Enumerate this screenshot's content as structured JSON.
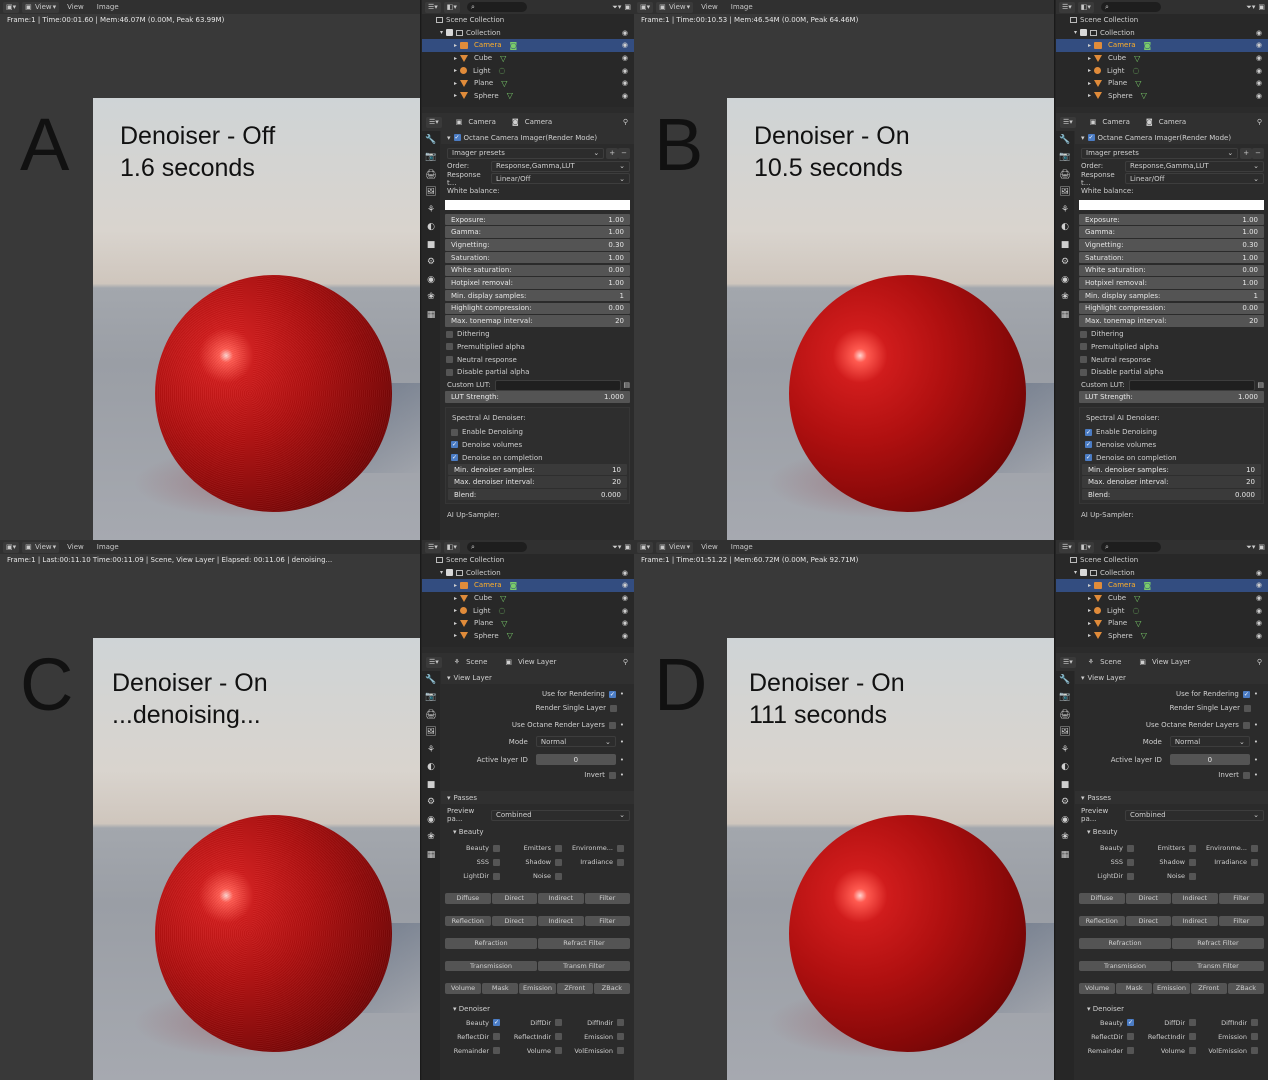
{
  "header": {
    "view": "View",
    "view_menu": "View",
    "image_menu": "Image"
  },
  "quads": [
    {
      "id": "A",
      "letter": "A",
      "line1": "Denoiser - Off",
      "line2": "1.6 seconds",
      "status": "Frame:1 | Time:00:01.60 | Mem:46.07M (0.00M, Peak 63.99M)"
    },
    {
      "id": "B",
      "letter": "B",
      "line1": "Denoiser - On",
      "line2": "10.5 seconds",
      "status": "Frame:1 | Time:00:10.53 | Mem:46.54M (0.00M, Peak 64.46M)"
    },
    {
      "id": "C",
      "letter": "C",
      "line1": "Denoiser - On",
      "line2": "...denoising...",
      "status": "Frame:1 | Last:00:11.10 Time:00:11.09 | Scene, View Layer | Elapsed: 00:11.06 | denoising..."
    },
    {
      "id": "D",
      "letter": "D",
      "line1": "Denoiser - On",
      "line2": "111 seconds",
      "status": "Frame:1 | Time:01:51.22 | Mem:60.72M (0.00M, Peak 92.71M)"
    }
  ],
  "outliner": {
    "root": "Scene Collection",
    "collection": "Collection",
    "items": [
      "Camera",
      "Cube",
      "Light",
      "Plane",
      "Sphere"
    ]
  },
  "camera_panel": {
    "tab1": "Camera",
    "tab2": "Camera",
    "section": "Octane Camera Imager(Render Mode)",
    "presets": "Imager presets",
    "order_label": "Order:",
    "order_value": "Response,Gamma,LUT",
    "response_label": "Response t...",
    "response_value": "Linear/Off",
    "wb_label": "White balance:",
    "sliders": [
      [
        "Exposure:",
        "1.00"
      ],
      [
        "Gamma:",
        "1.00"
      ],
      [
        "Vignetting:",
        "0.30"
      ],
      [
        "Saturation:",
        "1.00"
      ],
      [
        "White saturation:",
        "0.00"
      ],
      [
        "Hotpixel removal:",
        "1.00"
      ],
      [
        "Min. display samples:",
        "1"
      ],
      [
        "Highlight compression:",
        "0.00"
      ],
      [
        "Max. tonemap interval:",
        "20"
      ]
    ],
    "checks": [
      "Dithering",
      "Premultiplied alpha",
      "Neutral response",
      "Disable partial alpha"
    ],
    "lut_label": "Custom LUT:",
    "lut_strength": "LUT Strength:",
    "lut_strength_val": "1.000",
    "denoiser_title": "Spectral AI Denoiser:",
    "denoiser_checks": [
      "Enable Denoising",
      "Denoise volumes",
      "Denoise on completion"
    ],
    "denoiser_state_A": [
      false,
      true,
      true
    ],
    "denoiser_state_B": [
      true,
      true,
      true
    ],
    "denoiser_sliders": [
      [
        "Min. denoiser samples:",
        "10"
      ],
      [
        "Max. denoiser interval:",
        "20"
      ],
      [
        "Blend:",
        "0.000"
      ]
    ],
    "upsampler": "AI Up-Sampler:"
  },
  "viewlayer_panel": {
    "tab1": "Scene",
    "tab2": "View Layer",
    "section": "View Layer",
    "use_rendering": "Use for Rendering",
    "single_layer": "Render Single Layer",
    "octane_layers": "Use Octane Render Layers",
    "mode_label": "Mode",
    "mode_value": "Normal",
    "layer_id_label": "Active layer ID",
    "layer_id_value": "0",
    "invert": "Invert",
    "passes": "Passes",
    "preview_label": "Preview pa...",
    "preview_value": "Combined",
    "beauty": "Beauty",
    "beauty_checks": [
      [
        "Beauty",
        "Emitters",
        "Environme..."
      ],
      [
        "SSS",
        "Shadow",
        "Irradiance"
      ],
      [
        "LightDir",
        "Noise",
        ""
      ]
    ],
    "btn_rows": [
      [
        "Diffuse",
        "Direct",
        "Indirect",
        "Filter"
      ],
      [
        "Reflection",
        "Direct",
        "Indirect",
        "Filter"
      ],
      [
        "Refraction",
        "Refract Filter"
      ],
      [
        "Transmission",
        "Transm Filter"
      ],
      [
        "Volume",
        "Mask",
        "Emission",
        "ZFront",
        "ZBack"
      ]
    ],
    "denoiser": "Denoiser",
    "den_checks": [
      [
        "Beauty",
        "DiffDir",
        "DiffIndir"
      ],
      [
        "ReflectDir",
        "ReflectIndir",
        "Emission"
      ],
      [
        "Remainder",
        "Volume",
        "VolEmission"
      ]
    ]
  }
}
